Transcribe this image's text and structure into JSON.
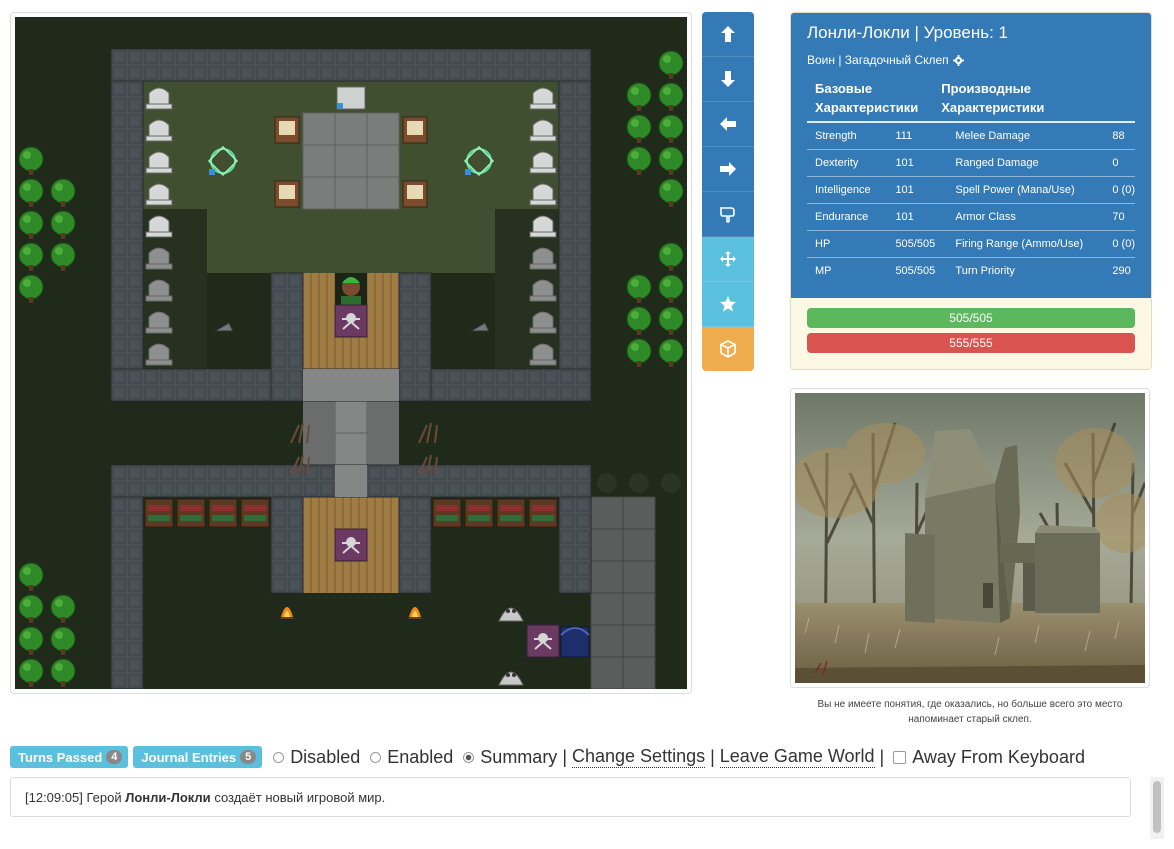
{
  "map": {
    "description_icons": [
      "tombstone-icon",
      "magic-circle-icon",
      "altar-icon",
      "hero-icon",
      "spider-icon",
      "bookshelf-icon",
      "campfire-icon",
      "skull-pile-icon",
      "tree-icon",
      "door-icon"
    ]
  },
  "controls": [
    {
      "name": "move-up-button",
      "icon": "arrow-up-icon",
      "style": "blue"
    },
    {
      "name": "move-down-button",
      "icon": "arrow-down-icon",
      "style": "blue"
    },
    {
      "name": "move-left-button",
      "icon": "arrow-left-icon",
      "style": "blue"
    },
    {
      "name": "move-right-button",
      "icon": "arrow-right-icon",
      "style": "blue"
    },
    {
      "name": "interact-button",
      "icon": "hand-pointer-icon",
      "style": "blue"
    },
    {
      "name": "move-mode-button",
      "icon": "crosshair-icon",
      "style": "light"
    },
    {
      "name": "favorite-button",
      "icon": "star-icon",
      "style": "light"
    },
    {
      "name": "inventory-button",
      "icon": "cube-icon",
      "style": "orange"
    }
  ],
  "character": {
    "title": "Лонли-Локли | Уровень: 1",
    "subtitle": "Воин | Загадочный Склеп",
    "base_header": "Базовые Характеристики",
    "derived_header": "Производные Характеристики",
    "rows": [
      {
        "base": "Strength",
        "base_val": "111",
        "derived": "Melee Damage",
        "derived_val": "88"
      },
      {
        "base": "Dexterity",
        "base_val": "101",
        "derived": "Ranged Damage",
        "derived_val": "0"
      },
      {
        "base": "Intelligence",
        "base_val": "101",
        "derived": "Spell Power (Mana/Use)",
        "derived_val": "0 (0)"
      },
      {
        "base": "Endurance",
        "base_val": "101",
        "derived": "Armor Class",
        "derived_val": "70"
      },
      {
        "base": "HP",
        "base_val": "505/505",
        "derived": "Firing Range (Ammo/Use)",
        "derived_val": "0 (0)"
      },
      {
        "base": "MP",
        "base_val": "505/505",
        "derived": "Turn Priority",
        "derived_val": "290"
      }
    ],
    "hp_bar": "505/505",
    "mp_bar": "555/555",
    "colors": {
      "header_bg": "#337ab7",
      "hp": "#5cb85c",
      "mp": "#d9534f"
    }
  },
  "location": {
    "caption": "Вы не имеете понятия, где оказались, но больше всего это место напоминает старый склеп."
  },
  "bottom": {
    "turns_label": "Turns Passed",
    "turns_count": "4",
    "journal_label": "Journal Entries",
    "journal_count": "5",
    "radio_disabled": "Disabled",
    "radio_enabled": "Enabled",
    "radio_summary": "Summary",
    "selected": "Summary",
    "sep": "|",
    "change_settings": "Change Settings",
    "leave_world": "Leave Game World",
    "afk": "Away From Keyboard"
  },
  "log": {
    "time": "[12:09:05]",
    "prefix": "Герой",
    "hero": "Лонли-Локли",
    "message": "создаёт новый игровой мир."
  }
}
